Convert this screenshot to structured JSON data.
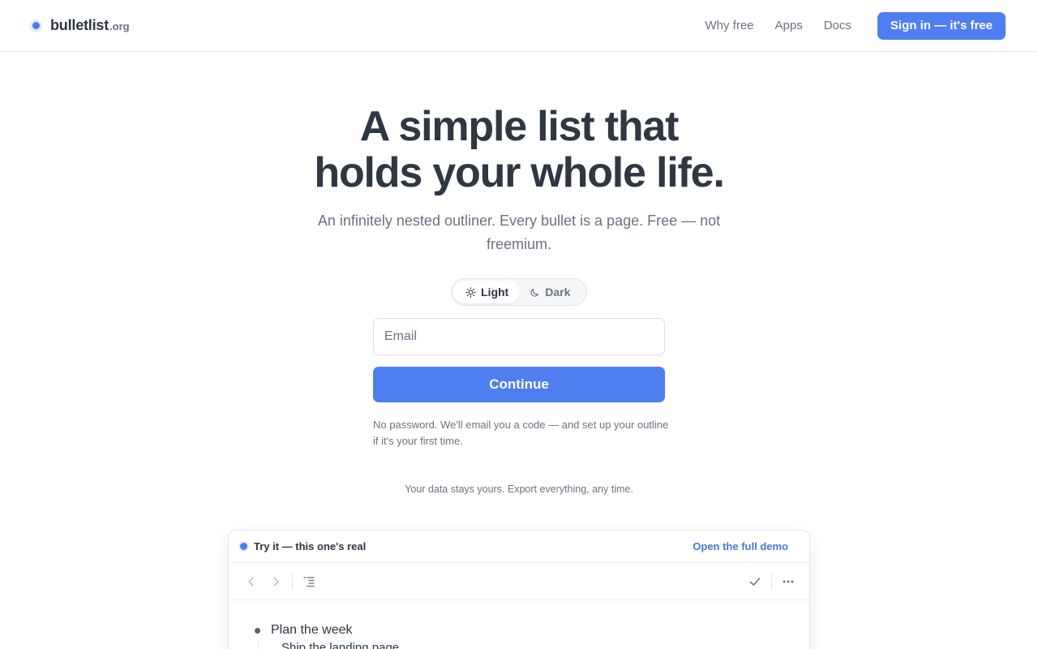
{
  "header": {
    "logo_name": "bulletlist",
    "logo_tld": ".org",
    "nav": [
      "Why free",
      "Apps",
      "Docs"
    ],
    "signin_label": "Sign in — it's free"
  },
  "hero": {
    "title_line1": "A simple list that",
    "title_line2": "holds your whole life.",
    "subtitle": "An infinitely nested outliner. Every bullet is a page. Free — not freemium."
  },
  "theme": {
    "light_label": "Light",
    "dark_label": "Dark",
    "selected": "Light"
  },
  "form": {
    "email_placeholder": "Email",
    "email_value": "",
    "continue_label": "Continue",
    "hint": "No password. We'll email you a code — and set up your outline if it's your first time."
  },
  "data_note": "Your data stays yours. Export everything, any time.",
  "demo": {
    "title": "Try it — this one's real",
    "open_link": "Open the full demo",
    "toolbar_icons": [
      "chevron-left-icon",
      "chevron-right-icon",
      "outline-list-icon",
      "check-icon",
      "more-icon"
    ],
    "items": [
      {
        "label": "Plan the week",
        "children": [
          "Ship the landing page"
        ]
      }
    ]
  },
  "colors": {
    "accent": "#4f7ef0",
    "text": "#2f3742",
    "muted": "#6b7280",
    "border": "#e3e6ea"
  }
}
